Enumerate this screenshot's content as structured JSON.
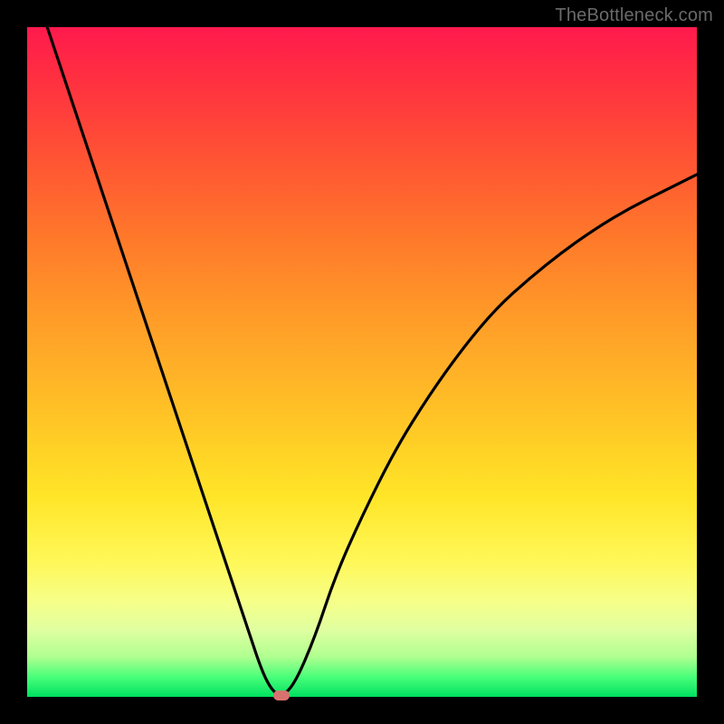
{
  "watermark": "TheBottleneck.com",
  "chart_data": {
    "type": "line",
    "title": "",
    "xlabel": "",
    "ylabel": "",
    "xlim": [
      0,
      100
    ],
    "ylim": [
      0,
      100
    ],
    "grid": false,
    "legend": false,
    "series": [
      {
        "name": "bottleneck-curve",
        "x": [
          3,
          6,
          9,
          12,
          15,
          18,
          21,
          24,
          27,
          30,
          33,
          35,
          36.5,
          38,
          40,
          43,
          46,
          50,
          55,
          60,
          65,
          70,
          75,
          80,
          85,
          90,
          95,
          100
        ],
        "y": [
          100,
          91,
          82,
          73,
          64,
          55,
          46,
          37,
          28,
          19,
          10,
          4,
          1,
          0,
          2,
          9,
          18,
          27,
          37,
          45,
          52,
          58,
          62.5,
          66.5,
          70,
          73,
          75.5,
          78
        ]
      }
    ],
    "marker": {
      "x": 38,
      "y": 0,
      "color": "#d8726f"
    },
    "gradient_stops": [
      {
        "pct": 0,
        "color": "#ff1a4d"
      },
      {
        "pct": 20,
        "color": "#ff5533"
      },
      {
        "pct": 45,
        "color": "#ffa028"
      },
      {
        "pct": 70,
        "color": "#ffe527"
      },
      {
        "pct": 90,
        "color": "#e0ffa0"
      },
      {
        "pct": 100,
        "color": "#00e060"
      }
    ]
  }
}
